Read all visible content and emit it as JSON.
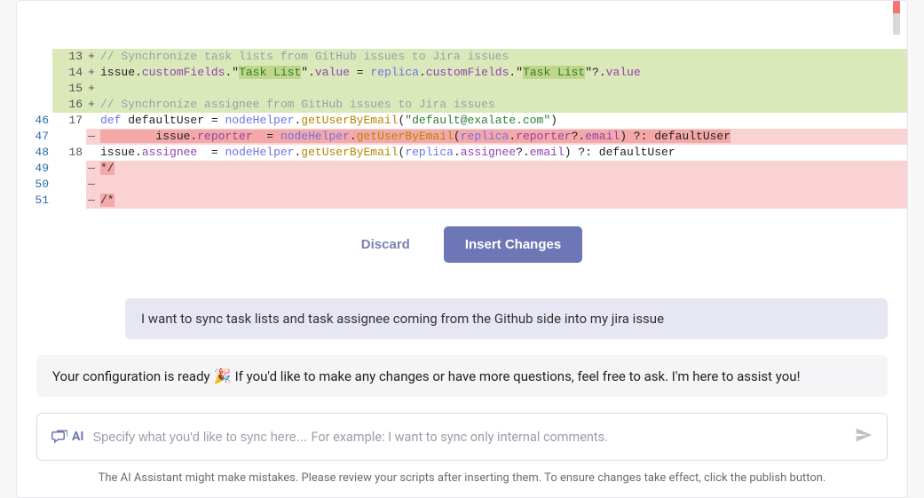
{
  "diff": {
    "rows": [
      {
        "left": "",
        "right": "13",
        "marker": "+",
        "green": true,
        "comment": "// Synchronize task lists from GitHub issues to Jira issues"
      },
      {
        "left": "",
        "right": "14",
        "marker": "+",
        "green": true,
        "tokens_key": "line14"
      },
      {
        "left": "",
        "right": "15",
        "marker": "+",
        "green": true,
        "blank": true
      },
      {
        "left": "",
        "right": "16",
        "marker": "+",
        "green": true,
        "comment": "// Synchronize assignee from GitHub issues to Jira issues"
      },
      {
        "left": "46",
        "right": "17",
        "marker": "",
        "tokens_key": "line17"
      },
      {
        "left": "47",
        "right": "",
        "marker": "—",
        "red_cell": true,
        "tokens_key": "line47"
      },
      {
        "left": "48",
        "right": "18",
        "marker": "",
        "tokens_key": "line18"
      },
      {
        "left": "49",
        "right": "",
        "marker": "—",
        "red_cell": true,
        "raw": "*/",
        "strong_red": true
      },
      {
        "left": "50",
        "right": "",
        "marker": "—",
        "red_cell": true,
        "raw": ""
      },
      {
        "left": "51",
        "right": "",
        "marker": "—",
        "red_cell": true,
        "raw": "/*",
        "strong_red": true
      }
    ]
  },
  "tokens": {
    "line14": [
      {
        "t": "issue",
        "c": "c-ident"
      },
      {
        "t": ".",
        "c": "c-op"
      },
      {
        "t": "customFields",
        "c": "c-prop"
      },
      {
        "t": ".",
        "c": "c-op"
      },
      {
        "t": "\"",
        "c": "c-op"
      },
      {
        "t": "Task List",
        "c": "c-str",
        "hl": "green"
      },
      {
        "t": "\"",
        "c": "c-op"
      },
      {
        "t": ".",
        "c": "c-op"
      },
      {
        "t": "value",
        "c": "c-prop"
      },
      {
        "t": " = ",
        "c": "c-op"
      },
      {
        "t": "replica",
        "c": "c-kw"
      },
      {
        "t": ".",
        "c": "c-op"
      },
      {
        "t": "customFields",
        "c": "c-prop"
      },
      {
        "t": ".",
        "c": "c-op"
      },
      {
        "t": "\"",
        "c": "c-op"
      },
      {
        "t": "Task List",
        "c": "c-str",
        "hl": "green"
      },
      {
        "t": "\"",
        "c": "c-op"
      },
      {
        "t": "?.",
        "c": "c-op"
      },
      {
        "t": "value",
        "c": "c-prop"
      }
    ],
    "line17": [
      {
        "t": "def",
        "c": "c-kw"
      },
      {
        "t": " defaultUser = ",
        "c": "c-ident"
      },
      {
        "t": "nodeHelper",
        "c": "c-kw"
      },
      {
        "t": ".",
        "c": "c-op"
      },
      {
        "t": "getUserByEmail",
        "c": "c-method"
      },
      {
        "t": "(",
        "c": "c-op"
      },
      {
        "t": "\"default@exalate.com\"",
        "c": "c-str"
      },
      {
        "t": ")",
        "c": "c-op"
      }
    ],
    "line47": [
      {
        "t": "        issue",
        "c": "c-ident",
        "hl": "red"
      },
      {
        "t": ".",
        "c": "c-op",
        "hl": "red"
      },
      {
        "t": "reporter",
        "c": "c-prop",
        "hl": "red"
      },
      {
        "t": "  = ",
        "c": "c-op",
        "hl": "red"
      },
      {
        "t": "nodeHelper",
        "c": "c-kw",
        "hl": "red"
      },
      {
        "t": ".",
        "c": "c-op",
        "hl": "red"
      },
      {
        "t": "getUserByEmail",
        "c": "c-method",
        "hl": "red"
      },
      {
        "t": "(",
        "c": "c-op",
        "hl": "red"
      },
      {
        "t": "replica",
        "c": "c-kw",
        "hl": "red"
      },
      {
        "t": ".",
        "c": "c-op",
        "hl": "red"
      },
      {
        "t": "reporter",
        "c": "c-prop",
        "hl": "red"
      },
      {
        "t": "?.",
        "c": "c-op",
        "hl": "red"
      },
      {
        "t": "email",
        "c": "c-prop",
        "hl": "red"
      },
      {
        "t": ") ?: defaultUser",
        "c": "c-ident",
        "hl": "red"
      }
    ],
    "line18": [
      {
        "t": "issue",
        "c": "c-ident"
      },
      {
        "t": ".",
        "c": "c-op"
      },
      {
        "t": "assignee",
        "c": "c-prop"
      },
      {
        "t": "  = ",
        "c": "c-op"
      },
      {
        "t": "nodeHelper",
        "c": "c-kw"
      },
      {
        "t": ".",
        "c": "c-op"
      },
      {
        "t": "getUserByEmail",
        "c": "c-method"
      },
      {
        "t": "(",
        "c": "c-op"
      },
      {
        "t": "replica",
        "c": "c-kw"
      },
      {
        "t": ".",
        "c": "c-op"
      },
      {
        "t": "assignee",
        "c": "c-prop"
      },
      {
        "t": "?.",
        "c": "c-op"
      },
      {
        "t": "email",
        "c": "c-prop"
      },
      {
        "t": ") ?: defaultUser",
        "c": "c-ident"
      }
    ]
  },
  "buttons": {
    "discard": "Discard",
    "insert": "Insert Changes"
  },
  "chat": {
    "user": "I want to sync task lists and task assignee coming from the Github side into my jira issue",
    "bot_pre": "Your configuration is ready ",
    "bot_emoji": "🎉",
    "bot_post": " If you'd like to make any changes or have more questions, feel free to ask. I'm here to assist you!",
    "ai_label": "AI",
    "placeholder": "Specify what you'd like to sync here...",
    "hint": "For example: I want to sync only internal comments."
  },
  "disclaimer": "The AI Assistant might make mistakes. Please review your scripts after inserting them. To ensure changes take effect, click the publish button."
}
